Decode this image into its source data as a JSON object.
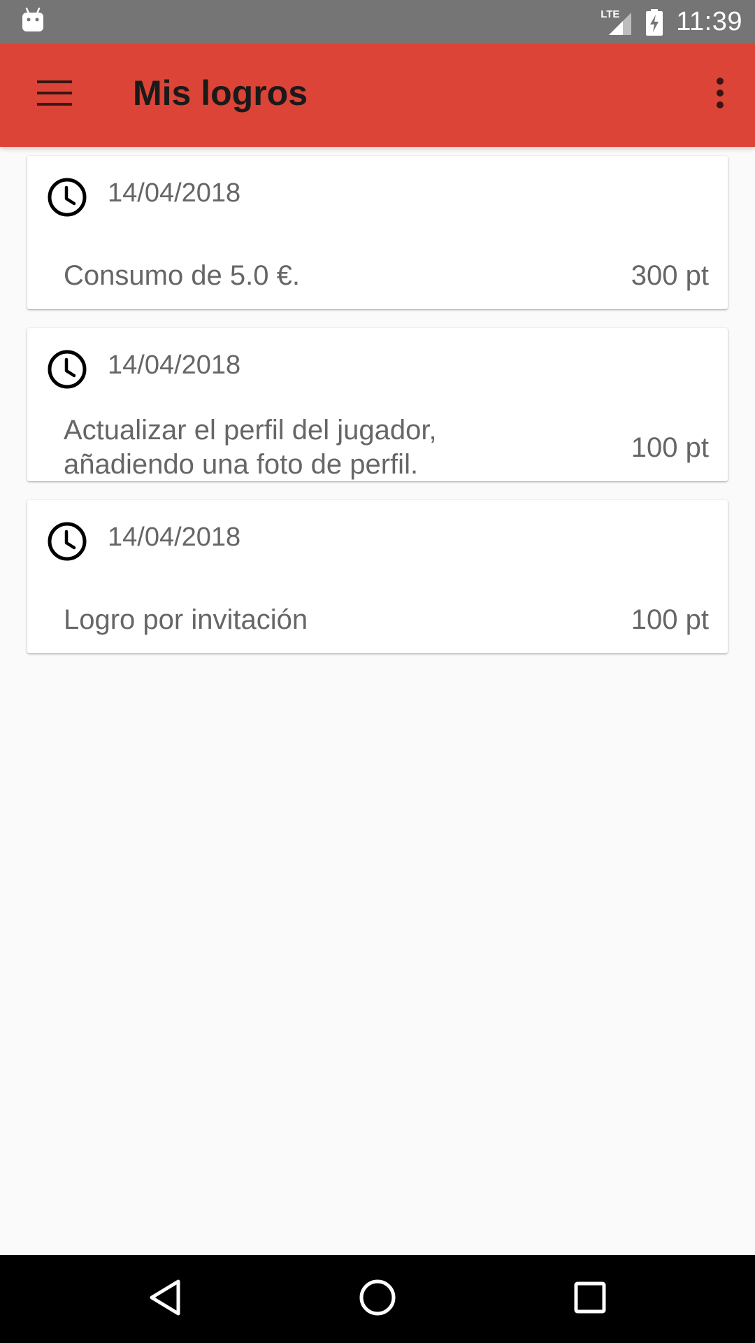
{
  "status_bar": {
    "notification_icon": "android-debug-icon",
    "network_label": "LTE",
    "signal_icon": "signal-icon",
    "battery_icon": "battery-charging-icon",
    "time": "11:39"
  },
  "app_bar": {
    "menu_icon": "menu-icon",
    "title": "Mis logros",
    "overflow_icon": "more-vert-icon",
    "background_color": "#db4437"
  },
  "achievements": [
    {
      "icon": "clock-icon",
      "date": "14/04/2018",
      "description": "Consumo de 5.0 €.",
      "points": "300 pt"
    },
    {
      "icon": "clock-icon",
      "date": "14/04/2018",
      "description": "Actualizar el perfil del jugador, añadiendo una foto de perfil.",
      "points": "100 pt"
    },
    {
      "icon": "clock-icon",
      "date": "14/04/2018",
      "description": "Logro por invitación",
      "points": "100 pt"
    }
  ],
  "nav_bar": {
    "back_icon": "back-triangle-icon",
    "home_icon": "home-circle-icon",
    "recents_icon": "recents-square-icon"
  }
}
